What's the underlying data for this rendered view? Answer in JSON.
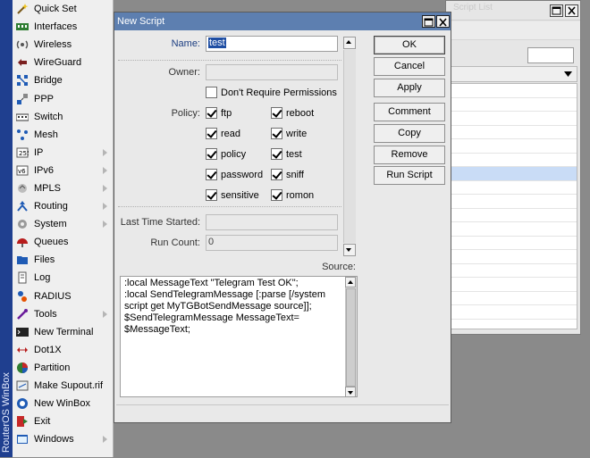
{
  "sidebar": {
    "brand": "RouterOS WinBox",
    "items": [
      {
        "label": "Quick Set",
        "icon": "wand-icon",
        "submenu": false
      },
      {
        "label": "Interfaces",
        "icon": "interfaces-icon",
        "submenu": false
      },
      {
        "label": "Wireless",
        "icon": "wireless-icon",
        "submenu": false
      },
      {
        "label": "WireGuard",
        "icon": "wireguard-icon",
        "submenu": false
      },
      {
        "label": "Bridge",
        "icon": "bridge-icon",
        "submenu": false
      },
      {
        "label": "PPP",
        "icon": "ppp-icon",
        "submenu": false
      },
      {
        "label": "Switch",
        "icon": "switch-icon",
        "submenu": false
      },
      {
        "label": "Mesh",
        "icon": "mesh-icon",
        "submenu": false
      },
      {
        "label": "IP",
        "icon": "ip-icon",
        "submenu": true
      },
      {
        "label": "IPv6",
        "icon": "ipv6-icon",
        "submenu": true
      },
      {
        "label": "MPLS",
        "icon": "mpls-icon",
        "submenu": true
      },
      {
        "label": "Routing",
        "icon": "routing-icon",
        "submenu": true
      },
      {
        "label": "System",
        "icon": "system-gear-icon",
        "submenu": true
      },
      {
        "label": "Queues",
        "icon": "queues-icon",
        "submenu": false
      },
      {
        "label": "Files",
        "icon": "folder-icon",
        "submenu": false
      },
      {
        "label": "Log",
        "icon": "log-icon",
        "submenu": false
      },
      {
        "label": "RADIUS",
        "icon": "radius-icon",
        "submenu": false
      },
      {
        "label": "Tools",
        "icon": "tools-icon",
        "submenu": true
      },
      {
        "label": "New Terminal",
        "icon": "terminal-icon",
        "submenu": false
      },
      {
        "label": "Dot1X",
        "icon": "dot1x-icon",
        "submenu": false
      },
      {
        "label": "Partition",
        "icon": "partition-icon",
        "submenu": false
      },
      {
        "label": "Make Supout.rif",
        "icon": "supout-icon",
        "submenu": false
      },
      {
        "label": "New WinBox",
        "icon": "winbox-icon",
        "submenu": false
      },
      {
        "label": "Exit",
        "icon": "exit-icon",
        "submenu": false
      },
      {
        "label": "Windows",
        "icon": "windows-icon",
        "submenu": true
      }
    ]
  },
  "background_window": {
    "title": "Script List",
    "rows": 17,
    "selected_row": 6
  },
  "dialog": {
    "title": "New Script",
    "fields": {
      "name_label": "Name:",
      "name_value": "test",
      "owner_label": "Owner:",
      "owner_value": "",
      "dont_require_permissions": "Don't Require Permissions",
      "policy_label": "Policy:",
      "last_time_started_label": "Last Time Started:",
      "last_time_started_value": "",
      "run_count_label": "Run Count:",
      "run_count_value": "0",
      "source_label": "Source:",
      "source_text": ":local MessageText \"Telegram Test OK\";\n:local SendTelegramMessage [:parse [/system script get MyTGBotSendMessage source]];\n$SendTelegramMessage MessageText=\n$MessageText;"
    },
    "policies": [
      {
        "label": "ftp",
        "checked": true
      },
      {
        "label": "reboot",
        "checked": true
      },
      {
        "label": "read",
        "checked": true
      },
      {
        "label": "write",
        "checked": true
      },
      {
        "label": "policy",
        "checked": true
      },
      {
        "label": "test",
        "checked": true
      },
      {
        "label": "password",
        "checked": true
      },
      {
        "label": "sniff",
        "checked": true
      },
      {
        "label": "sensitive",
        "checked": true
      },
      {
        "label": "romon",
        "checked": true
      }
    ],
    "buttons": {
      "ok": "OK",
      "cancel": "Cancel",
      "apply": "Apply",
      "comment": "Comment",
      "copy": "Copy",
      "remove": "Remove",
      "run_script": "Run Script"
    }
  },
  "colors": {
    "title_bar": "#5d7fb0",
    "brand_strip": "#1f3f8f",
    "selection_highlight": "#1f4ea3"
  }
}
